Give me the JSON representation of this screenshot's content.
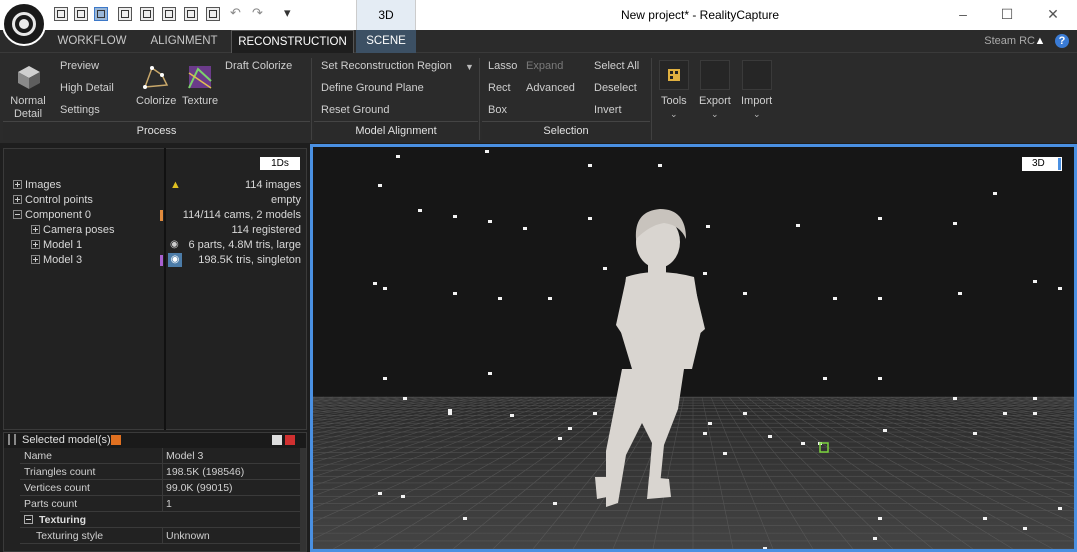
{
  "window": {
    "title": "New project* - RealityCapture",
    "context_tab": "3D",
    "controls": [
      "–",
      "☐",
      "✕"
    ]
  },
  "menu": {
    "tabs": [
      "WORKFLOW",
      "ALIGNMENT",
      "RECONSTRUCTION",
      "SCENE"
    ],
    "active": "RECONSTRUCTION",
    "account": "Steam RC"
  },
  "ribbon": {
    "process": {
      "normal_detail": "Normal Detail",
      "preview": "Preview",
      "high_detail": "High Detail",
      "settings": "Settings",
      "colorize": "Colorize",
      "texture": "Texture",
      "draft_colorize": "Draft Colorize",
      "footer": "Process"
    },
    "model_alignment": {
      "set_region": "Set Reconstruction Region",
      "define_ground": "Define Ground Plane",
      "reset_ground": "Reset Ground",
      "footer": "Model Alignment"
    },
    "selection": {
      "lasso": "Lasso",
      "expand": "Expand",
      "select_all": "Select All",
      "rect": "Rect",
      "advanced": "Advanced",
      "deselect": "Deselect",
      "box": "Box",
      "invert": "Invert",
      "footer": "Selection"
    },
    "tools": {
      "tools": "Tools",
      "export": "Export",
      "import": "Import"
    }
  },
  "tree": {
    "mode_button": "1Ds",
    "items": [
      {
        "label": "Images",
        "value": "114 images"
      },
      {
        "label": "Control points",
        "value": "empty"
      },
      {
        "label": "Component 0",
        "value": "114/114 cams, 2 models"
      },
      {
        "label": "Camera poses",
        "value": "114 registered"
      },
      {
        "label": "Model 1",
        "value": "6 parts, 4.8M tris, large"
      },
      {
        "label": "Model 3",
        "value": "198.5K tris, singleton"
      }
    ]
  },
  "selected": {
    "header": "Selected model(s)",
    "rows": [
      {
        "k": "Name",
        "v": "Model 3"
      },
      {
        "k": "Triangles count",
        "v": "198.5K (198546)"
      },
      {
        "k": "Vertices count",
        "v": "99.0K (99015)"
      },
      {
        "k": "Parts count",
        "v": "1"
      }
    ],
    "section": "Texturing",
    "section_rows": [
      {
        "k": "Texturing style",
        "v": "Unknown"
      }
    ]
  },
  "viewport": {
    "mode_label": "3D",
    "accent": "#4a90e2"
  }
}
